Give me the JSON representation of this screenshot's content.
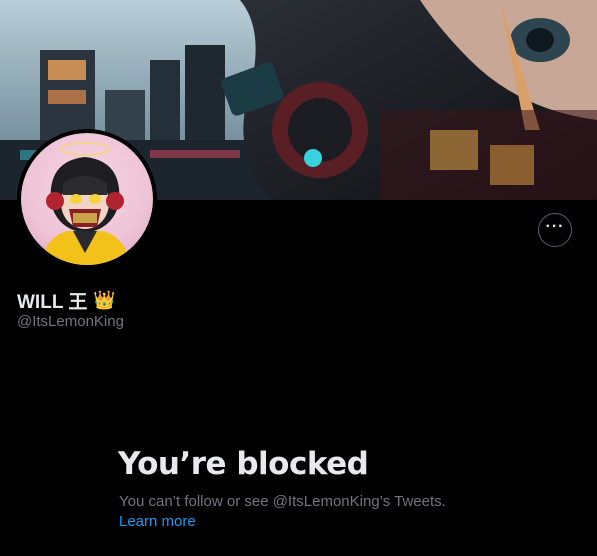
{
  "profile": {
    "name": "WILL 王",
    "name_emoji": "👑",
    "handle": "@ItsLemonKing",
    "more_button_label": "···"
  },
  "blocked": {
    "title": "You’re blocked",
    "description": "You can’t follow or see @ItsLemonKing’s Tweets.",
    "learn_more": "Learn more"
  },
  "colors": {
    "background": "#000000",
    "primary_text": "#e7e9ea",
    "secondary_text": "#71767b",
    "link": "#1d9bf0",
    "border": "#536471"
  }
}
